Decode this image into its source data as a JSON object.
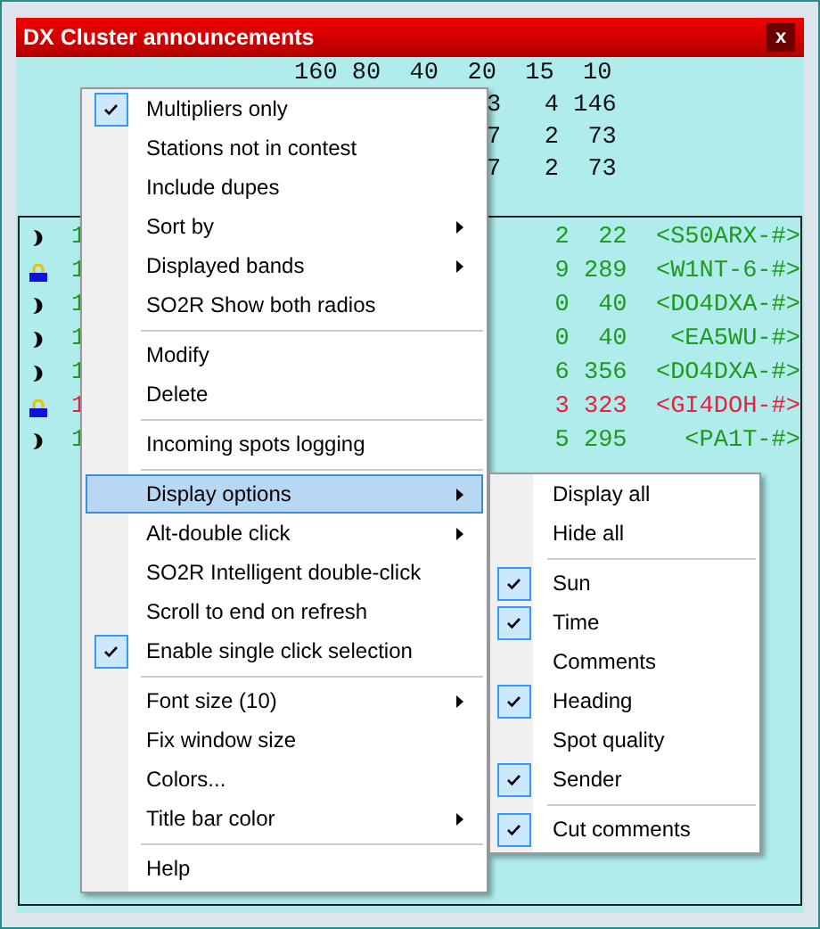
{
  "window": {
    "title": "DX Cluster announcements",
    "close_label": "x"
  },
  "band_header": "160 80  40  20  15  10",
  "summary_rows": [
    "3   4 146",
    "7   2  73",
    "7   2  73"
  ],
  "spots": [
    {
      "kind": "moon",
      "first": "1",
      "rest": "2  22  <S50ARX-#>",
      "color": "#1e9a1e"
    },
    {
      "kind": "lock",
      "first": "1",
      "rest": "9 289  <W1NT-6-#>",
      "color": "#1e9a1e"
    },
    {
      "kind": "moon",
      "first": "1",
      "rest": "0  40  <DO4DXA-#>",
      "color": "#1e9a1e"
    },
    {
      "kind": "moon",
      "first": "1",
      "rest": "0  40   <EA5WU-#>",
      "color": "#1e9a1e"
    },
    {
      "kind": "moon",
      "first": "1",
      "rest": "6 356  <DO4DXA-#>",
      "color": "#1e9a1e"
    },
    {
      "kind": "lock",
      "first": "1",
      "rest": "3 323  <GI4DOH-#>",
      "color": "#e8213c"
    },
    {
      "kind": "moon",
      "first": "1",
      "rest": "5 295    <PA1T-#>",
      "color": "#1e9a1e"
    }
  ],
  "context_menu": {
    "items": [
      {
        "kind": "item",
        "label": "Multipliers only",
        "checked": true,
        "submenu": false,
        "selected": false
      },
      {
        "kind": "item",
        "label": "Stations not in contest",
        "checked": false,
        "submenu": false,
        "selected": false
      },
      {
        "kind": "item",
        "label": "Include dupes",
        "checked": false,
        "submenu": false,
        "selected": false
      },
      {
        "kind": "item",
        "label": "Sort by",
        "checked": false,
        "submenu": true,
        "selected": false
      },
      {
        "kind": "item",
        "label": "Displayed bands",
        "checked": false,
        "submenu": true,
        "selected": false
      },
      {
        "kind": "item",
        "label": "SO2R Show both radios",
        "checked": false,
        "submenu": false,
        "selected": false
      },
      {
        "kind": "separator"
      },
      {
        "kind": "item",
        "label": "Modify",
        "checked": false,
        "submenu": false,
        "selected": false
      },
      {
        "kind": "item",
        "label": "Delete",
        "checked": false,
        "submenu": false,
        "selected": false
      },
      {
        "kind": "separator"
      },
      {
        "kind": "item",
        "label": "Incoming spots logging",
        "checked": false,
        "submenu": false,
        "selected": false
      },
      {
        "kind": "separator"
      },
      {
        "kind": "item",
        "label": "Display options",
        "checked": false,
        "submenu": true,
        "selected": true
      },
      {
        "kind": "item",
        "label": "Alt-double click",
        "checked": false,
        "submenu": true,
        "selected": false
      },
      {
        "kind": "item",
        "label": "SO2R Intelligent double-click",
        "checked": false,
        "submenu": false,
        "selected": false
      },
      {
        "kind": "item",
        "label": "Scroll to end on refresh",
        "checked": false,
        "submenu": false,
        "selected": false
      },
      {
        "kind": "item",
        "label": "Enable single click selection",
        "checked": true,
        "submenu": false,
        "selected": false
      },
      {
        "kind": "separator"
      },
      {
        "kind": "item",
        "label": "Font size (10)",
        "checked": false,
        "submenu": true,
        "selected": false
      },
      {
        "kind": "item",
        "label": "Fix window size",
        "checked": false,
        "submenu": false,
        "selected": false
      },
      {
        "kind": "item",
        "label": "Colors...",
        "checked": false,
        "submenu": false,
        "selected": false
      },
      {
        "kind": "item",
        "label": "Title bar color",
        "checked": false,
        "submenu": true,
        "selected": false
      },
      {
        "kind": "separator"
      },
      {
        "kind": "item",
        "label": "Help",
        "checked": false,
        "submenu": false,
        "selected": false
      }
    ]
  },
  "submenu": {
    "items": [
      {
        "kind": "item",
        "label": "Display all",
        "checked": false
      },
      {
        "kind": "item",
        "label": "Hide all",
        "checked": false
      },
      {
        "kind": "separator"
      },
      {
        "kind": "item",
        "label": "Sun",
        "checked": true
      },
      {
        "kind": "item",
        "label": "Time",
        "checked": true
      },
      {
        "kind": "item",
        "label": "Comments",
        "checked": false
      },
      {
        "kind": "item",
        "label": "Heading",
        "checked": true
      },
      {
        "kind": "item",
        "label": "Spot quality",
        "checked": false
      },
      {
        "kind": "item",
        "label": "Sender",
        "checked": true
      },
      {
        "kind": "separator"
      },
      {
        "kind": "item",
        "label": "Cut comments",
        "checked": true
      }
    ]
  }
}
